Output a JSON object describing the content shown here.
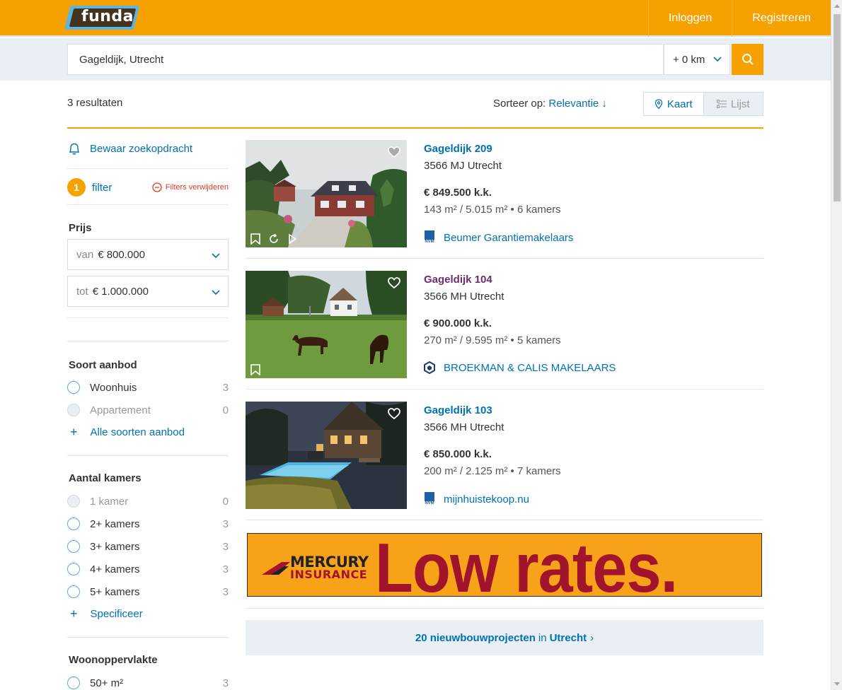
{
  "header": {
    "logo_text": "funda",
    "nav": {
      "login": "Inloggen",
      "register": "Registreren"
    },
    "colors": {
      "brand": "#f7a100",
      "link": "#0071b3",
      "visited": "#6c2c6b",
      "danger": "#e0382c"
    }
  },
  "search": {
    "value": "Gageldijk, Utrecht",
    "radius": "+ 0 km",
    "button_icon": "search-icon"
  },
  "results": {
    "count": "3 resultaten",
    "sort_label": "Sorteer op:",
    "sort_value": "Relevantie ↓",
    "view_map": "Kaart",
    "view_list": "Lijst"
  },
  "sidebar": {
    "save_search": "Bewaar zoekopdracht",
    "filter_count": "1",
    "filter_label": "filter",
    "clear_filters": "Filters verwijderen",
    "price": {
      "heading": "Prijs",
      "from_prefix": "van",
      "from_value": "€ 800.000",
      "to_prefix": "tot",
      "to_value": "€ 1.000.000"
    },
    "offer_type": {
      "heading": "Soort aanbod",
      "options": [
        {
          "label": "Woonhuis",
          "count": "3"
        },
        {
          "label": "Appartement",
          "count": "0"
        }
      ],
      "more": "Alle soorten aanbod"
    },
    "rooms": {
      "heading": "Aantal kamers",
      "options": [
        {
          "label": "1 kamer",
          "count": "0"
        },
        {
          "label": "2+ kamers",
          "count": "3"
        },
        {
          "label": "3+ kamers",
          "count": "3"
        },
        {
          "label": "4+ kamers",
          "count": "3"
        },
        {
          "label": "5+ kamers",
          "count": "3"
        }
      ],
      "more": "Specificeer"
    },
    "area": {
      "heading": "Woonoppervlakte",
      "options": [
        {
          "label": "50+ m²",
          "count": "3"
        }
      ]
    }
  },
  "listings": [
    {
      "title": "Gageldijk 209",
      "zip": "3566 MJ Utrecht",
      "price": "€ 849.500 k.k.",
      "specs": "143 m² / 5.015 m² • 6 kamers",
      "agent": "Beumer Garantiemakelaars",
      "agent_logo": "nvm"
    },
    {
      "title": "Gageldijk 104",
      "zip": "3566 MH Utrecht",
      "price": "€ 900.000 k.k.",
      "specs": "270 m² / 9.595 m² • 5 kamers",
      "agent": "BROEKMAN & CALIS MAKELAARS",
      "agent_logo": "vbo"
    },
    {
      "title": "Gageldijk 103",
      "zip": "3566 MH Utrecht",
      "price": "€ 850.000 k.k.",
      "specs": "200 m² / 2.125 m² • 7 kamers",
      "agent": "mijnhuistekoop.nu",
      "agent_logo": "nvm"
    }
  ],
  "ad": {
    "brand_line1": "MERCURY",
    "brand_line2": "INSURANCE",
    "slogan": "Low rates."
  },
  "newbuild": {
    "count_text": "20 nieuwbouwprojecten",
    "in": "in",
    "city": "Utrecht",
    "arrow": "›"
  }
}
